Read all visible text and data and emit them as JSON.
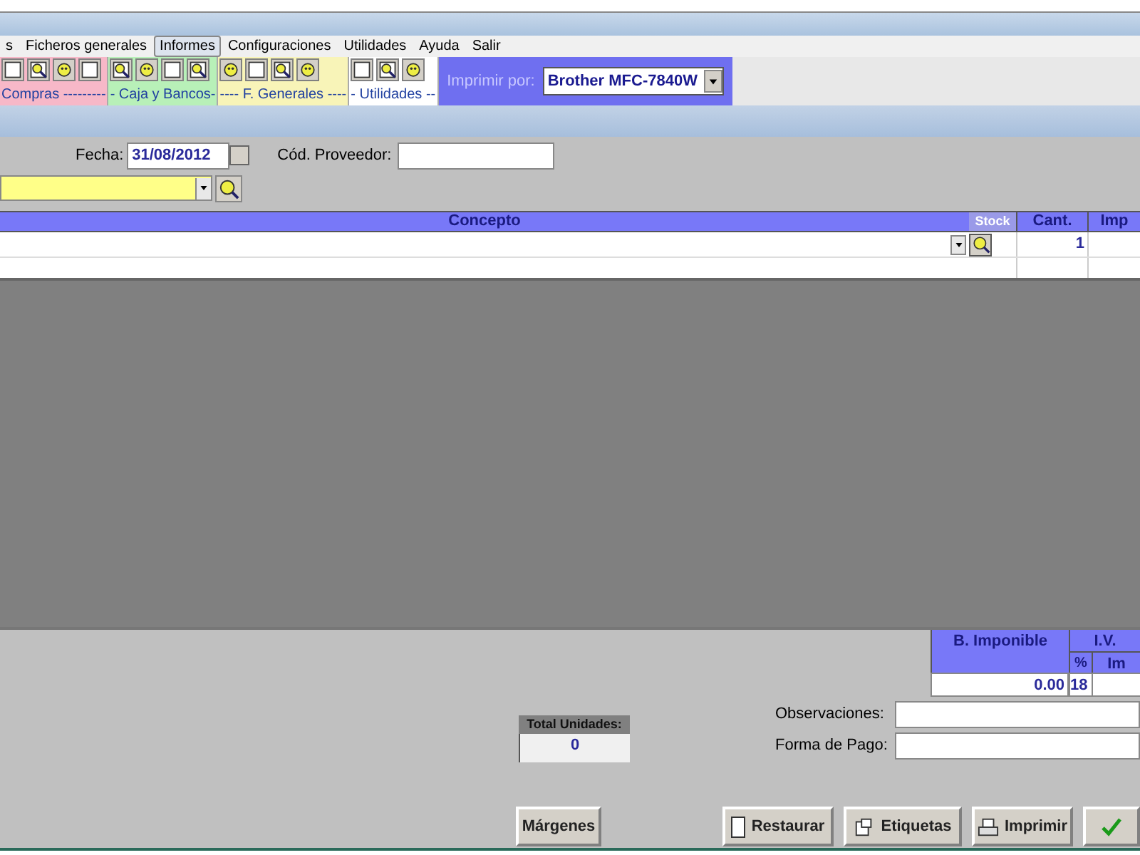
{
  "menu": [
    {
      "label": "s",
      "selected": false
    },
    {
      "label": "Ficheros generales",
      "selected": false
    },
    {
      "label": "Informes",
      "selected": true
    },
    {
      "label": "Configuraciones",
      "selected": false
    },
    {
      "label": "Utilidades",
      "selected": false
    },
    {
      "label": "Ayuda",
      "selected": false
    },
    {
      "label": "Salir",
      "selected": false
    }
  ],
  "toolbar_groups": [
    {
      "label": "Compras ---------",
      "color": "#f7b8c8"
    },
    {
      "label": "- Caja y Bancos-",
      "color": "#b8f0b8"
    },
    {
      "label": "---- F. Generales ----",
      "color": "#f8f4b8"
    },
    {
      "label": "- Utilidades --",
      "color": "#ffffff"
    }
  ],
  "printer": {
    "label": "Imprimir por:",
    "value": "Brother MFC-7840W"
  },
  "form": {
    "date_label": "Fecha:",
    "date": "31/08/2012",
    "supplier_label": "Cód. Proveedor:"
  },
  "grid": {
    "columns": [
      "Concepto",
      "Stock",
      "Cant.",
      "Imp"
    ],
    "rows": [
      {
        "quantity": "1"
      }
    ]
  },
  "totals": {
    "base_label": "B. Imponible",
    "vat_label": "I.V.",
    "percent_label": "%",
    "amount_label": "Im",
    "base": "0.00",
    "percent": "18"
  },
  "units": {
    "label": "Total Unidades:",
    "value": "0"
  },
  "notes_label": "Observaciones:",
  "payment_label": "Forma de Pago:",
  "buttons": [
    {
      "label": "Márgenes",
      "kind": "plain"
    },
    {
      "label": "Restaurar",
      "kind": "restore"
    },
    {
      "label": "Etiquetas",
      "kind": "labels"
    },
    {
      "label": "Imprimir",
      "kind": "print"
    },
    {
      "kind": "accept"
    }
  ]
}
